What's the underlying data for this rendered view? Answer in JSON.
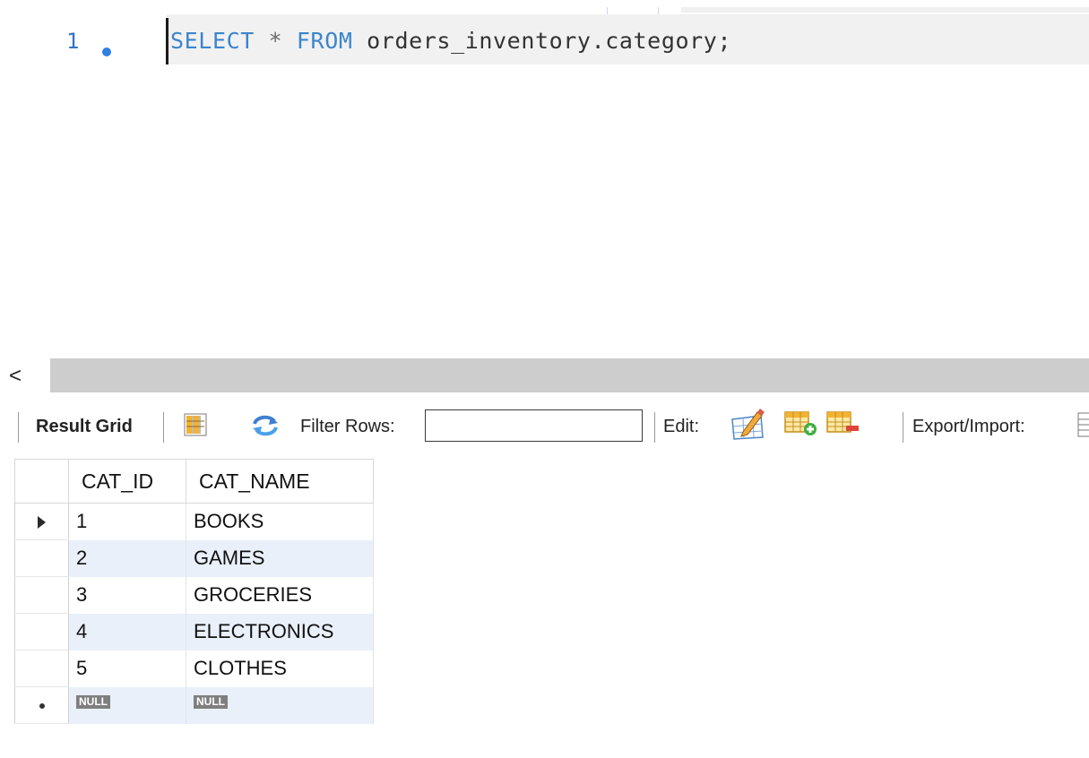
{
  "editor": {
    "line_number": "1",
    "query": {
      "kw_select": "SELECT",
      "star": "*",
      "kw_from": "FROM",
      "table": "orders_inventory.category;"
    }
  },
  "scrollbar": {
    "left_arrow": "<"
  },
  "toolbar": {
    "result_grid_label": "Result Grid",
    "filter_rows_label": "Filter Rows:",
    "filter_value": "",
    "edit_label": "Edit:",
    "export_import_label": "Export/Import:"
  },
  "grid": {
    "columns": [
      "CAT_ID",
      "CAT_NAME"
    ],
    "rows": [
      {
        "cat_id": "1",
        "cat_name": "BOOKS"
      },
      {
        "cat_id": "2",
        "cat_name": "GAMES"
      },
      {
        "cat_id": "3",
        "cat_name": "GROCERIES"
      },
      {
        "cat_id": "4",
        "cat_name": "ELECTRONICS"
      },
      {
        "cat_id": "5",
        "cat_name": "CLOTHES"
      }
    ],
    "null_label": "NULL"
  },
  "colors": {
    "keyword": "#3b86cc",
    "line_number": "#3173c8",
    "selected_row": "#e9f0fa",
    "scroll_track": "#cdcdcd"
  },
  "icons": [
    "toggle-results-icon",
    "refresh-icon",
    "edit-row-icon",
    "add-row-icon",
    "delete-row-icon",
    "export-icon"
  ]
}
